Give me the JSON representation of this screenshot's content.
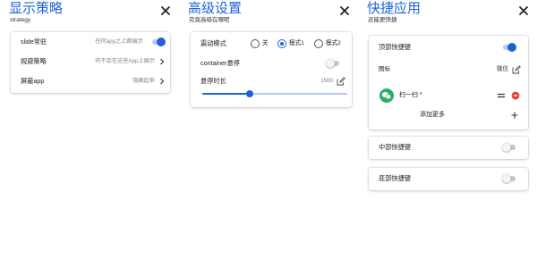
{
  "colors": {
    "accent": "#1e63d6",
    "delete_red": "#e8413b",
    "wechat_green": "#2aae67"
  },
  "strategy_panel": {
    "title": "显示策略",
    "subtitle": "strategy",
    "close_icon": "close-icon",
    "rows": [
      {
        "label": "slide常驻",
        "value": "任何app之上都展示",
        "control": "toggle",
        "on": true
      },
      {
        "label": "规避策略",
        "value": "将不会在这些App上展示",
        "control": "chevron"
      },
      {
        "label": "屏蔽app",
        "value": "隐藏起来",
        "control": "chevron"
      }
    ]
  },
  "advanced_panel": {
    "title": "高级设置",
    "subtitle": "究竟高级在哪呢",
    "close_icon": "close-icon",
    "vibration": {
      "label": "震动模式",
      "options": [
        "关",
        "模式1",
        "模式2"
      ],
      "selected": "模式1"
    },
    "container_hover": {
      "label": "container悬停",
      "on": false
    },
    "hover_duration": {
      "label": "悬停时长",
      "value": "1500",
      "slider_fraction": 0.33,
      "edit_icon": "edit-icon"
    }
  },
  "shortcut_panel": {
    "title": "快捷应用",
    "subtitle": "还能更快捷",
    "close_icon": "close-icon",
    "top": {
      "label": "顶部快捷键",
      "on": true,
      "icon_label": "图标",
      "icon_value": "微信",
      "app": {
        "name": "扫一扫 *",
        "icon": "wechat-icon"
      },
      "add_more": "添加更多",
      "add_icon": "plus-icon"
    },
    "middle": {
      "label": "中部快捷键",
      "on": false
    },
    "bottom": {
      "label": "底部快捷键",
      "on": false
    }
  }
}
